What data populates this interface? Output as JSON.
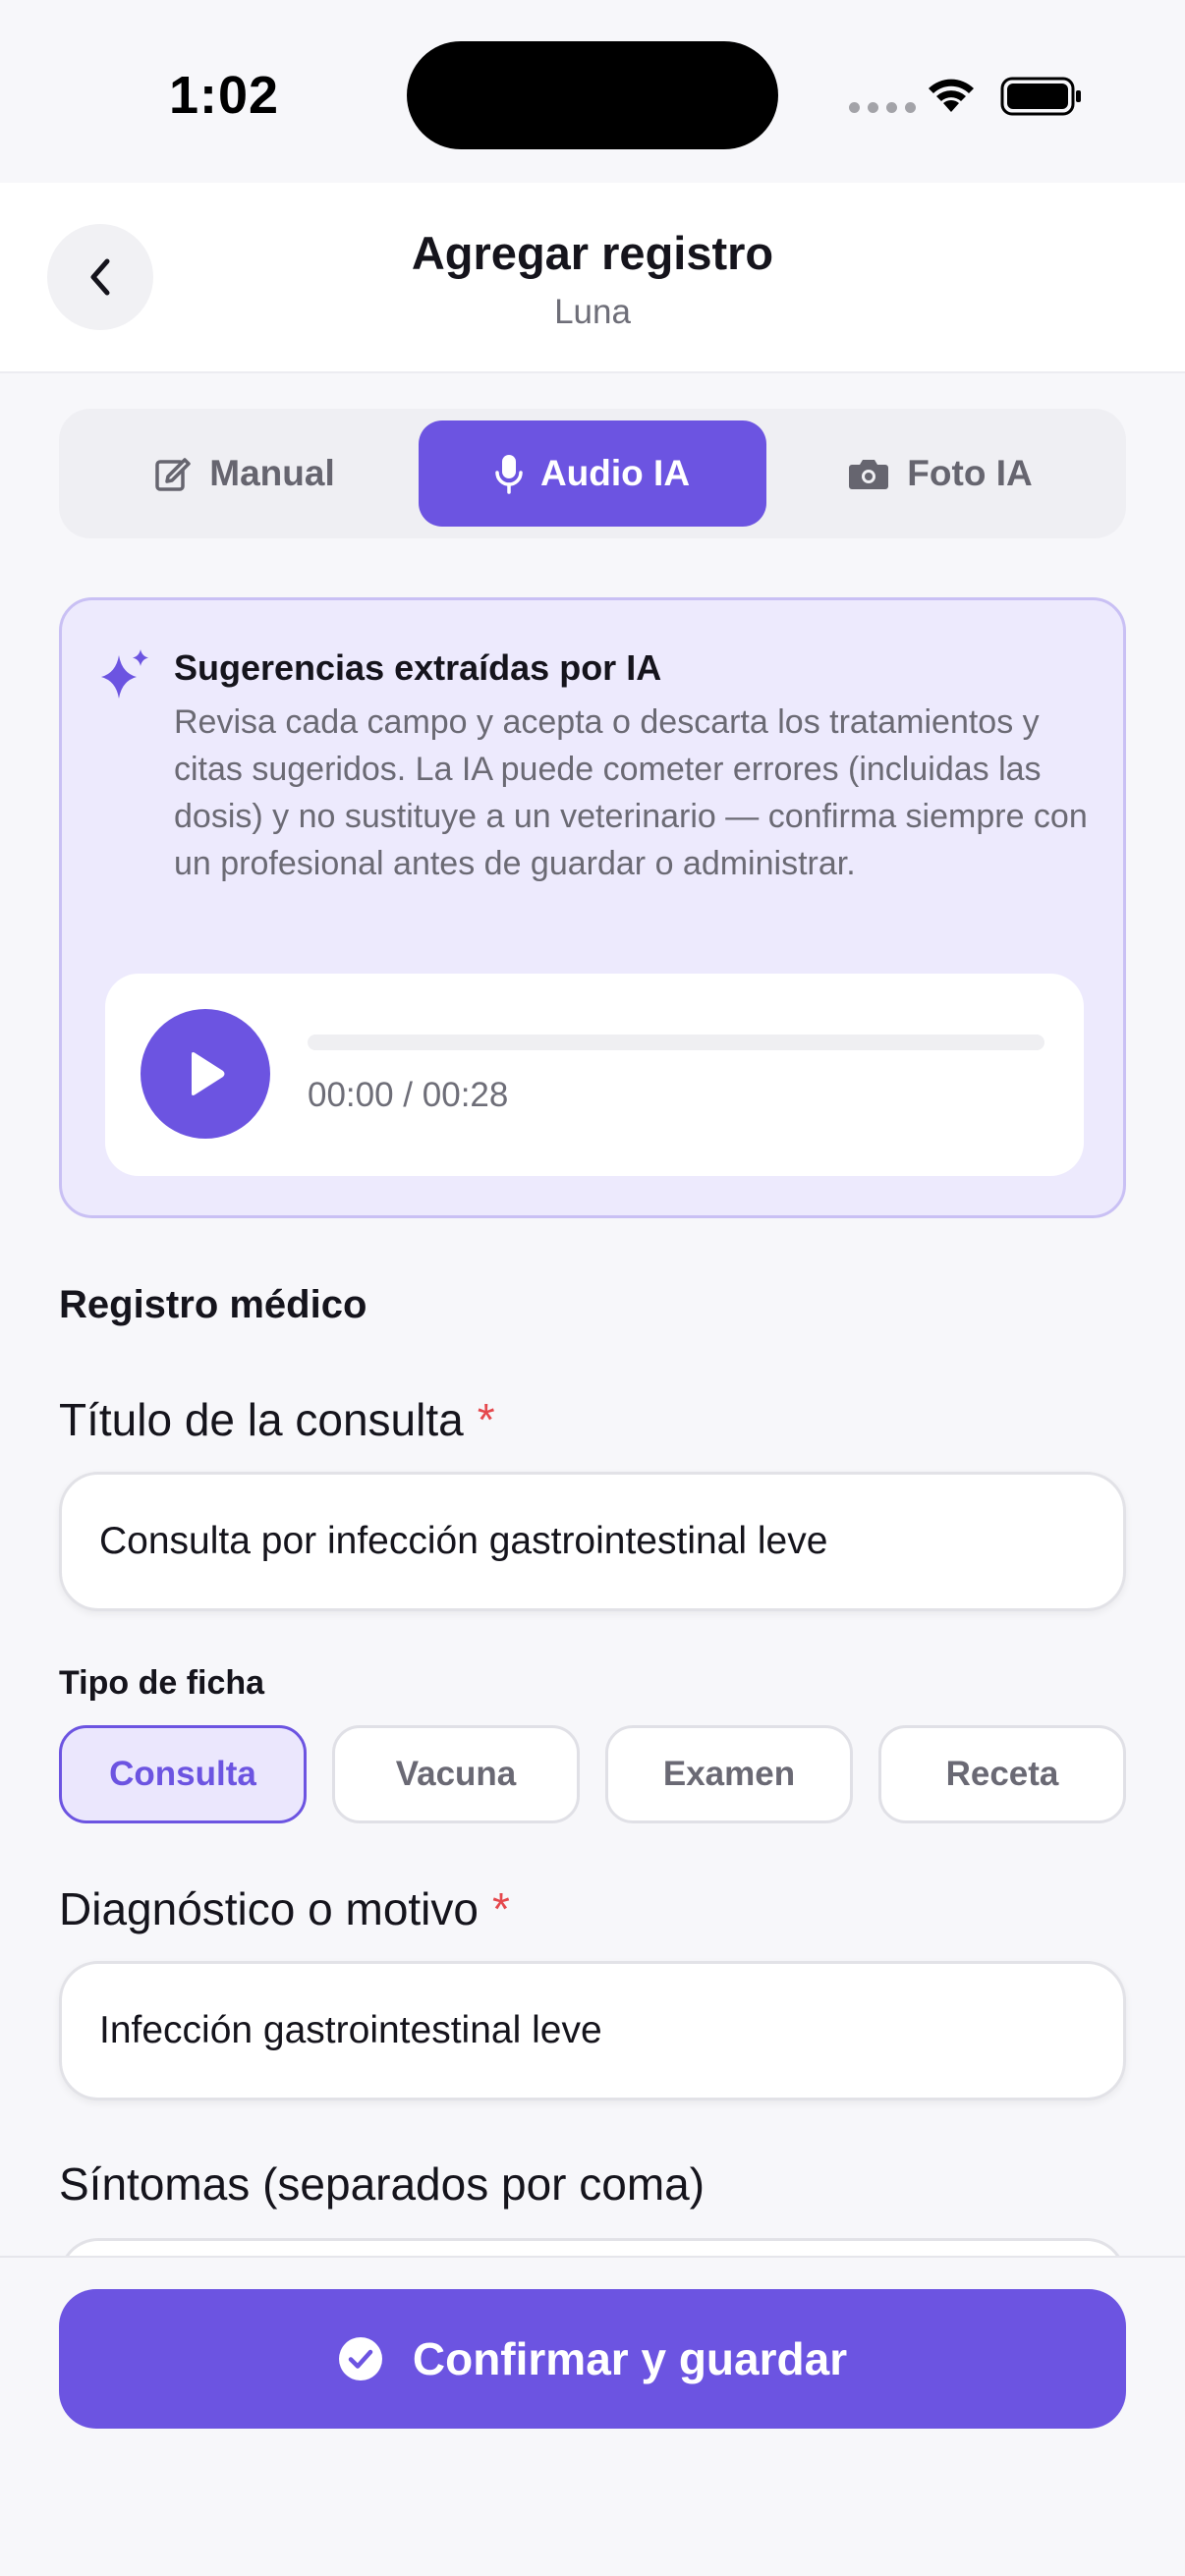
{
  "status_bar": {
    "time": "1:02"
  },
  "header": {
    "title": "Agregar registro",
    "subtitle": "Luna"
  },
  "modes": [
    {
      "label": "Manual",
      "icon": "edit-icon",
      "selected": false
    },
    {
      "label": "Audio IA",
      "icon": "microphone-icon",
      "selected": true
    },
    {
      "label": "Foto IA",
      "icon": "camera-icon",
      "selected": false
    }
  ],
  "ai_card": {
    "title": "Sugerencias extraídas por IA",
    "body": "Revisa cada campo y acepta o descarta los tratamientos y citas sugeridos. La IA puede cometer errores (incluidas las dosis) y no sustituye a un veterinario — confirma siempre con un profesional antes de guardar o administrar.",
    "audio": {
      "time": "00:00 / 00:28",
      "progress": 0
    }
  },
  "form": {
    "section_title": "Registro médico",
    "title_field": {
      "label": "Título de la consulta",
      "required_mark": "*",
      "value": "Consulta por infección gastrointestinal leve"
    },
    "record_type": {
      "label": "Tipo de ficha",
      "options": [
        "Consulta",
        "Vacuna",
        "Examen",
        "Receta"
      ],
      "selected": "Consulta"
    },
    "diagnosis_field": {
      "label": "Diagnóstico o motivo",
      "required_mark": "*",
      "value": "Infección gastrointestinal leve"
    },
    "symptoms_field": {
      "label": "Síntomas (separados por coma)"
    }
  },
  "footer": {
    "confirm_label": "Confirmar y guardar"
  },
  "colors": {
    "accent": "#6c54e1",
    "accent_light": "#edeafd",
    "required": "#e5484d"
  }
}
